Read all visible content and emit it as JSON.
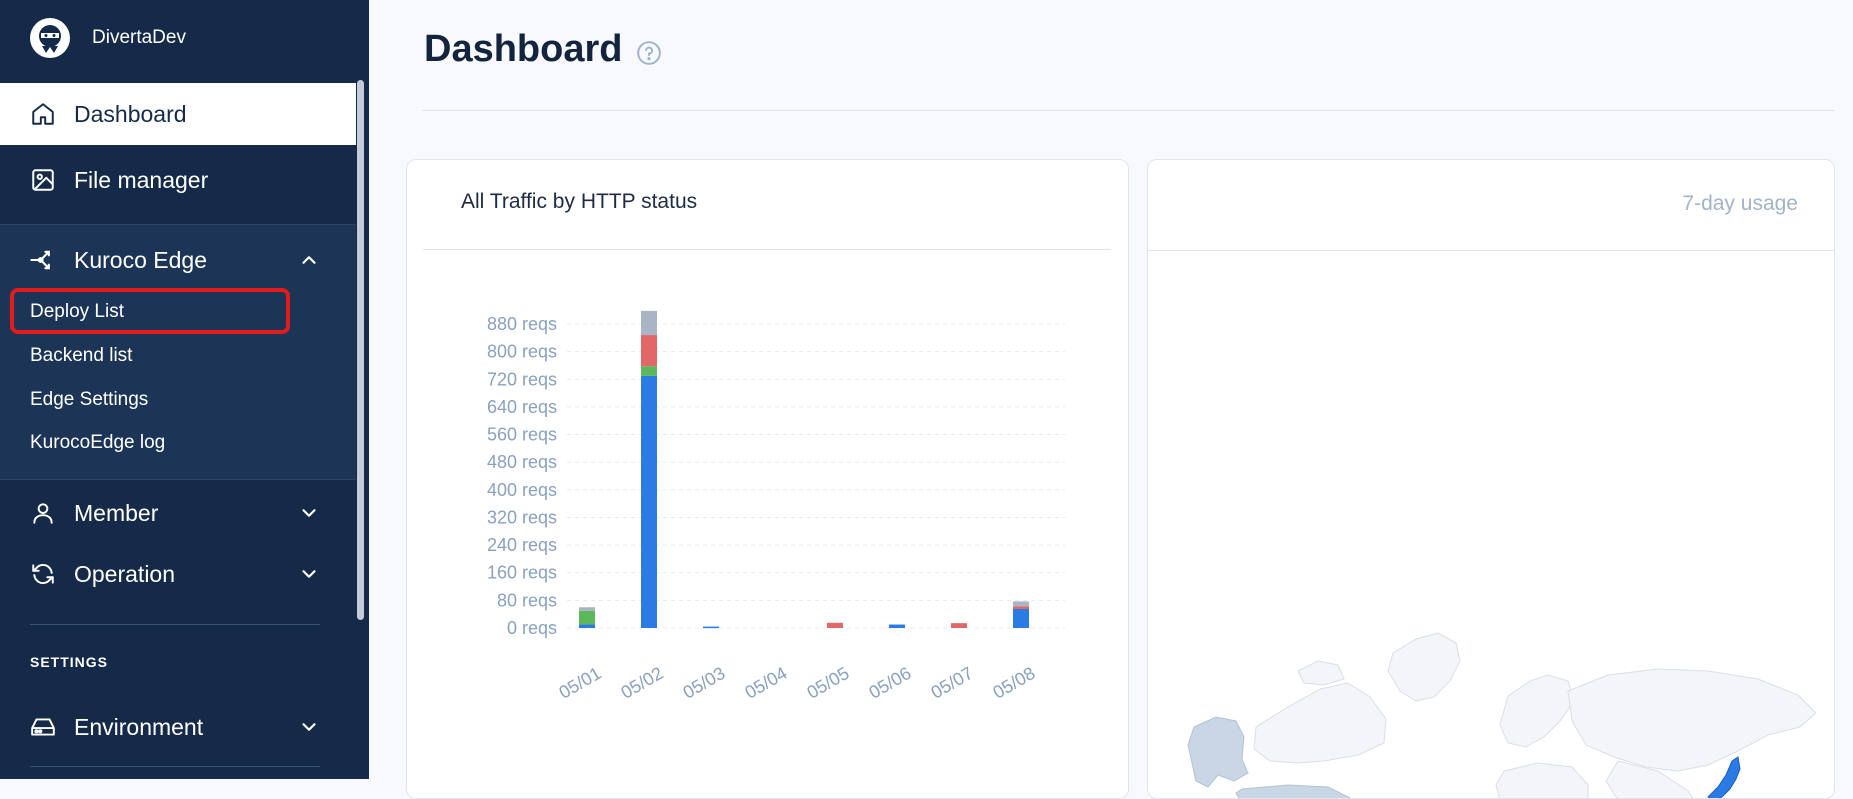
{
  "sidebar": {
    "brand": "DivertaDev",
    "items": [
      {
        "label": "Dashboard",
        "icon": "home-icon",
        "active": true
      },
      {
        "label": "File manager",
        "icon": "image-icon"
      },
      {
        "label": "Kuroco Edge",
        "icon": "share-icon",
        "expanded": true
      },
      {
        "label": "Member",
        "icon": "user-icon"
      },
      {
        "label": "Operation",
        "icon": "refresh-icon"
      },
      {
        "label": "Environment",
        "icon": "drive-icon"
      }
    ],
    "edge_subitems": [
      "Deploy List",
      "Backend list",
      "Edge Settings",
      "KurocoEdge log"
    ],
    "settings_label": "SETTINGS",
    "highlight_color": "#e31b1b"
  },
  "page": {
    "title": "Dashboard"
  },
  "traffic_card": {
    "title": "All Traffic by HTTP status"
  },
  "usage_card": {
    "title": "7-day usage"
  },
  "chart_data": {
    "type": "bar",
    "stacked": true,
    "categories": [
      "05/01",
      "05/02",
      "05/03",
      "05/04",
      "05/05",
      "05/06",
      "05/07",
      "05/08"
    ],
    "series": [
      {
        "color": "#2a7be4",
        "values": [
          10,
          730,
          4,
          0,
          0,
          10,
          0,
          55
        ]
      },
      {
        "color": "#5cb85c",
        "values": [
          40,
          28,
          0,
          0,
          0,
          0,
          0,
          0
        ]
      },
      {
        "color": "#e26767",
        "values": [
          0,
          90,
          0,
          0,
          15,
          0,
          14,
          8
        ]
      },
      {
        "color": "#a9b4c4",
        "values": [
          10,
          70,
          0,
          0,
          0,
          0,
          0,
          14
        ]
      }
    ],
    "y_tick_values": [
      0,
      80,
      160,
      240,
      320,
      400,
      480,
      560,
      640,
      720,
      800,
      880
    ],
    "y_tick_labels": [
      "0 reqs",
      "80 reqs",
      "160 reqs",
      "240 reqs",
      "320 reqs",
      "400 reqs",
      "480 reqs",
      "560 reqs",
      "640 reqs",
      "720 reqs",
      "800 reqs",
      "880 reqs"
    ],
    "ylim": [
      0,
      880
    ],
    "grid": true,
    "title": "",
    "xlabel": "",
    "ylabel": ""
  },
  "colors": {
    "sidebar_bg": "#142a48",
    "accent_blue": "#2a7be4",
    "map_highlight": "#2a7be4",
    "map_visited": "#c9d6e6"
  }
}
